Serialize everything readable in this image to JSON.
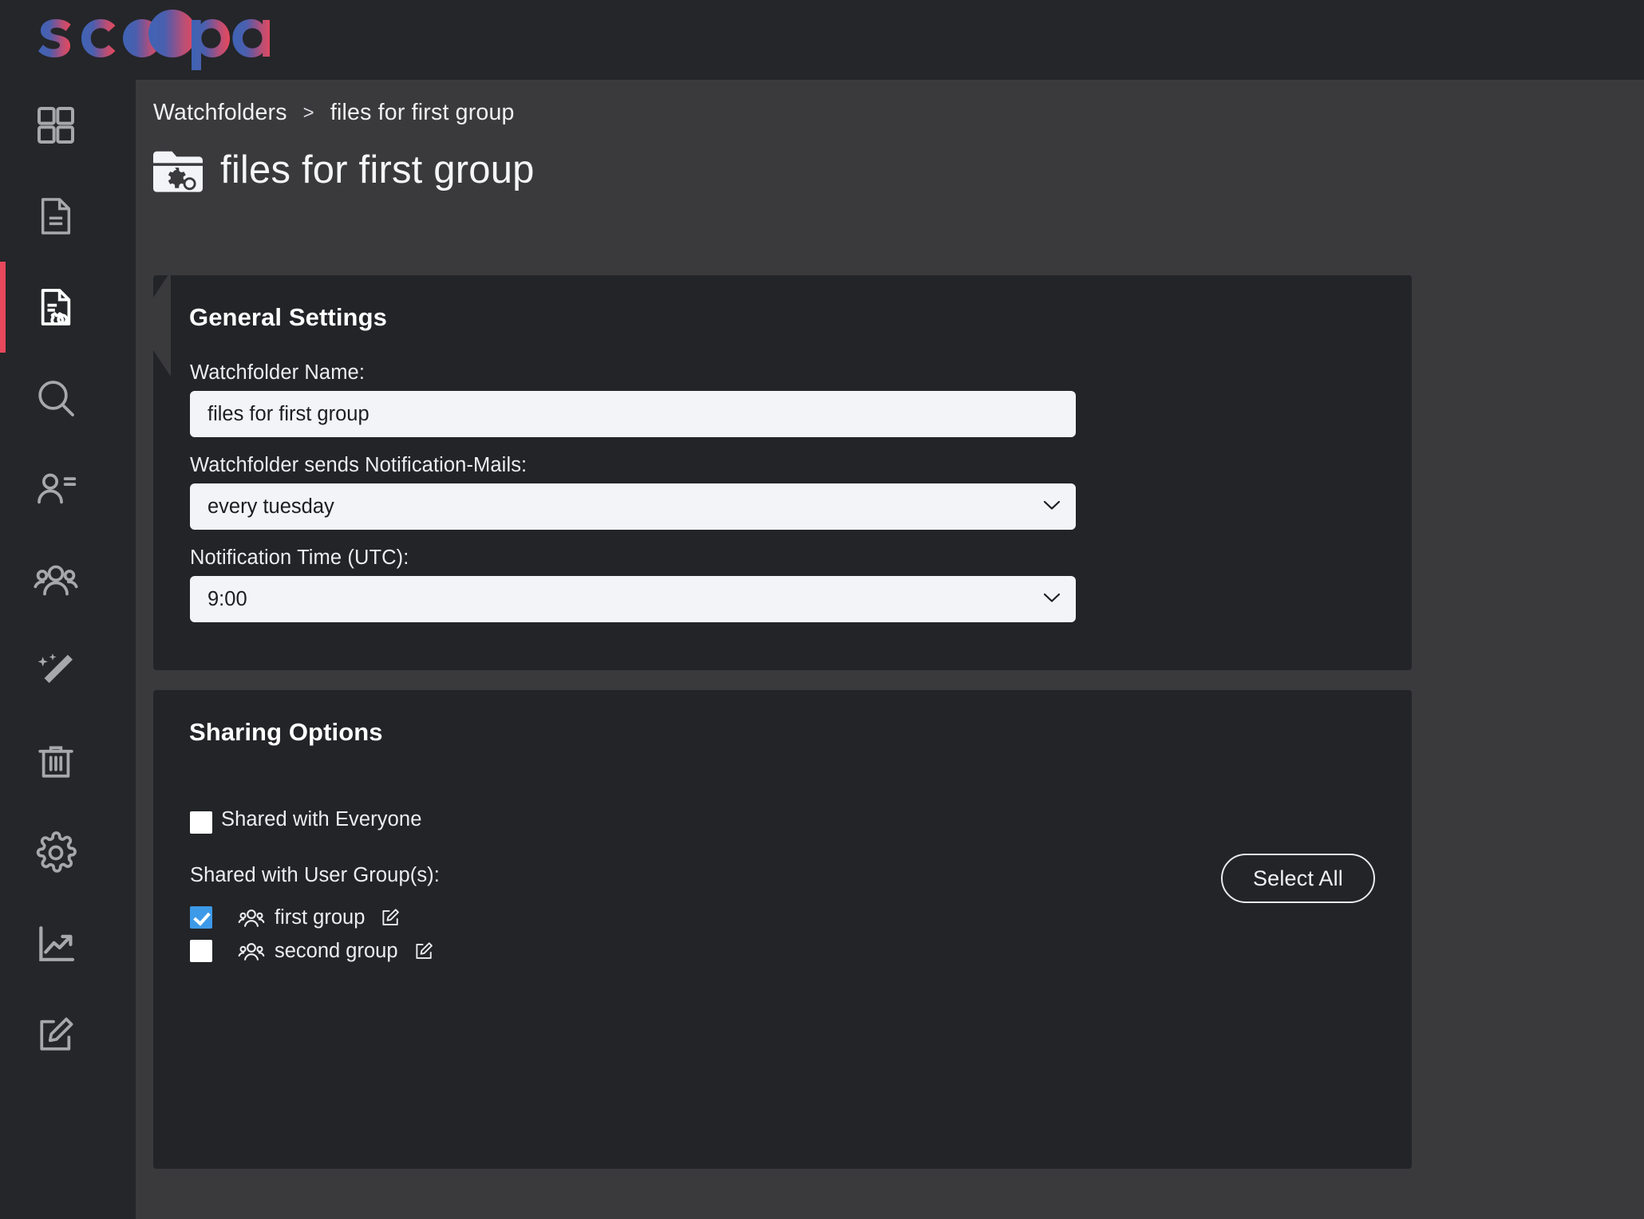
{
  "app": {
    "logo_text": "scoopa",
    "accent_color": "#e8485c",
    "checkbox_checked_color": "#3d9ae8"
  },
  "sidebar": {
    "items": [
      {
        "name": "dashboard",
        "icon": "grid-icon",
        "active": false
      },
      {
        "name": "documents",
        "icon": "document-icon",
        "active": false
      },
      {
        "name": "watchfolders",
        "icon": "document-gear-icon",
        "active": true
      },
      {
        "name": "search",
        "icon": "search-icon",
        "active": false
      },
      {
        "name": "users",
        "icon": "user-list-icon",
        "active": false
      },
      {
        "name": "user-groups",
        "icon": "users-group-icon",
        "active": false
      },
      {
        "name": "magic",
        "icon": "magic-wand-icon",
        "active": false
      },
      {
        "name": "trash",
        "icon": "trash-icon",
        "active": false
      },
      {
        "name": "settings",
        "icon": "gear-icon",
        "active": false
      },
      {
        "name": "statistics",
        "icon": "trend-chart-icon",
        "active": false
      },
      {
        "name": "editor",
        "icon": "edit-square-icon",
        "active": false
      }
    ]
  },
  "breadcrumb": {
    "root": "Watchfolders",
    "separator": ">",
    "current": "files for first group"
  },
  "header": {
    "title": "files for first group",
    "icon": "folder-gear-icon"
  },
  "general_settings": {
    "card_title": "General Settings",
    "name_label": "Watchfolder Name:",
    "name_value": "files for first group",
    "name_placeholder": "Watchfolder Name",
    "notification_label": "Watchfolder sends Notification-Mails:",
    "notification_value": "every tuesday",
    "time_label": "Notification Time (UTC):",
    "time_value": "9:00"
  },
  "sharing_options": {
    "card_title": "Sharing Options",
    "shared_everyone_label": "Shared with Everyone",
    "shared_everyone_checked": false,
    "groups_label": "Shared with User Group(s):",
    "select_all_label": "Select All",
    "groups": [
      {
        "name": "first group",
        "checked": true
      },
      {
        "name": "second group",
        "checked": false
      }
    ]
  }
}
